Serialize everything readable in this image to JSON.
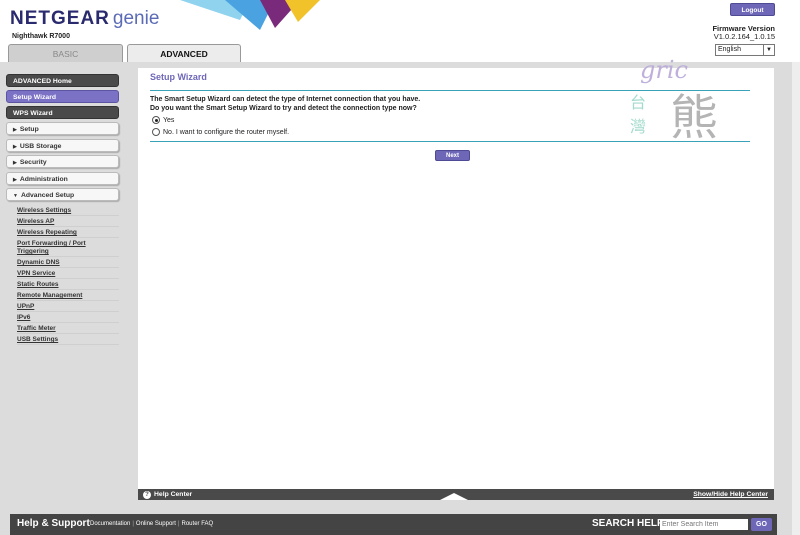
{
  "header": {
    "brand": "NETGEAR",
    "brand_genie": "genie",
    "model": "Nighthawk R7000",
    "logout_label": "Logout",
    "firmware_label": "Firmware Version",
    "firmware_version": "V1.0.2.164_1.0.15",
    "language": "English"
  },
  "tabs": {
    "basic": "BASIC",
    "advanced": "ADVANCED"
  },
  "sidebar": {
    "advanced_home": "ADVANCED Home",
    "setup_wizard": "Setup Wizard",
    "wps_wizard": "WPS Wizard",
    "setup": "Setup",
    "usb_storage": "USB Storage",
    "security": "Security",
    "administration": "Administration",
    "advanced_setup": "Advanced Setup",
    "sub_items": [
      "Wireless Settings",
      "Wireless AP",
      "Wireless Repeating",
      "Port Forwarding / Port",
      "Triggering",
      "Dynamic DNS",
      "VPN Service",
      "Static Routes",
      "Remote Management",
      "UPnP",
      "IPv6",
      "Traffic Meter",
      "USB Settings"
    ]
  },
  "main": {
    "title": "Setup Wizard",
    "question_line1": "The Smart Setup Wizard can detect the type of Internet connection that you have.",
    "question_line2": "Do you want the Smart Setup Wizard to try and detect the connection type now?",
    "option_yes": "Yes",
    "option_no": "No. I want to configure the router myself.",
    "next_label": "Next",
    "watermark_script": "gric",
    "watermark_cjk_1": "台",
    "watermark_cjk_2": "灣",
    "watermark_cjk_3": "熊"
  },
  "help_bar": {
    "help_center": "Help Center",
    "toggle": "Show/Hide Help Center"
  },
  "footer": {
    "help_support": "Help & Support",
    "links": [
      "Documentation",
      "Online Support",
      "Router FAQ"
    ],
    "search_help": "SEARCH HELP",
    "search_placeholder": "Enter Search Item",
    "go_label": "GO"
  },
  "colors": {
    "accent_purple": "#6e67b8",
    "divider_teal": "#3aa3b7",
    "nav_dark": "#4a4a4a"
  }
}
